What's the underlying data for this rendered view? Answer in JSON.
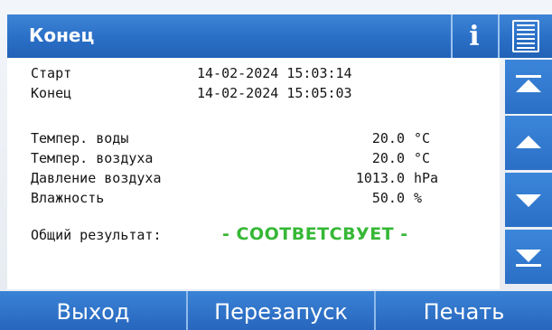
{
  "title": "Конец",
  "toolbar": {
    "info_label": "i",
    "menu_icon": "list-icon"
  },
  "rows": {
    "start": {
      "label": "Старт",
      "value": "14-02-2024 15:03:14"
    },
    "end": {
      "label": "Конец",
      "value": "14-02-2024 15:05:03"
    },
    "water_temp": {
      "label": "Темпер. воды",
      "value": "20.0",
      "unit": "°C"
    },
    "air_temp": {
      "label": "Темпер. воздуха",
      "value": "20.0",
      "unit": "°C"
    },
    "air_pressure": {
      "label": "Давление воздуха",
      "value": "1013.0",
      "unit": "hPa"
    },
    "humidity": {
      "label": "Влажность",
      "value": "50.0",
      "unit": "%"
    },
    "result": {
      "label": "Общий результат:",
      "value": "- СООТВЕТСВУЕТ -"
    }
  },
  "scroll": [
    "scroll-top-icon",
    "scroll-up-icon",
    "scroll-down-icon",
    "scroll-bottom-icon"
  ],
  "bottom": {
    "exit": "Выход",
    "restart": "Перезапуск",
    "print": "Печать"
  },
  "colors": {
    "accent": "#2a6fc6",
    "result": "#36b836"
  }
}
